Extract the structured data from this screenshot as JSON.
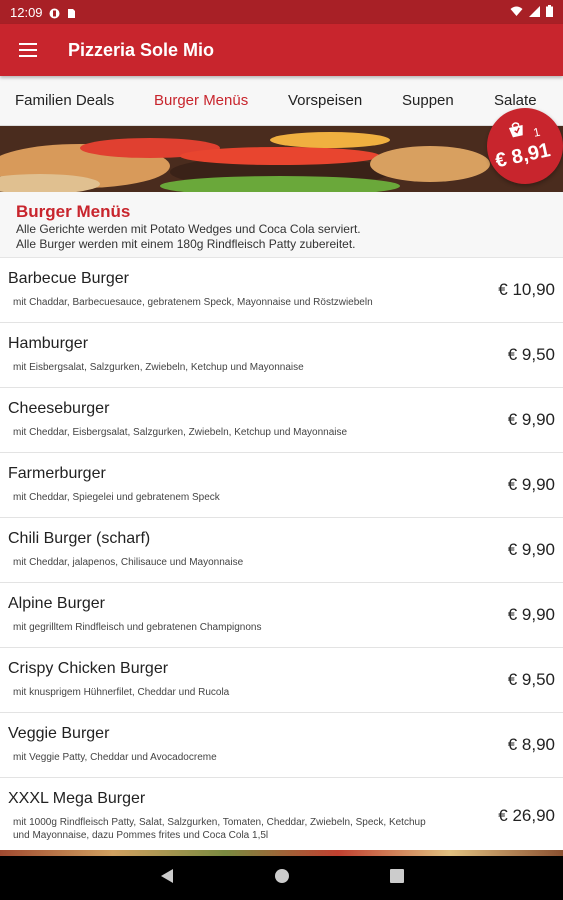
{
  "status_bar": {
    "time": "12:09"
  },
  "app": {
    "title": "Pizzeria Sole Mio"
  },
  "tabs": [
    {
      "label": "Familien Deals",
      "active": false
    },
    {
      "label": "Burger Menüs",
      "active": true
    },
    {
      "label": "Vorspeisen",
      "active": false
    },
    {
      "label": "Suppen",
      "active": false
    },
    {
      "label": "Salate",
      "active": false
    }
  ],
  "cart": {
    "count": "1",
    "total": "€ 8,91"
  },
  "section": {
    "title": "Burger Menüs",
    "desc_line1": "Alle Gerichte werden mit Potato Wedges und Coca Cola serviert.",
    "desc_line2": "Alle Burger werden mit einem 180g Rindfleisch Patty zubereitet."
  },
  "items": [
    {
      "name": "Barbecue Burger",
      "desc": "mit Chaddar, Barbecuesauce, gebratenem Speck, Mayonnaise und Röstzwiebeln",
      "price": "€ 10,90"
    },
    {
      "name": "Hamburger",
      "desc": "mit Eisbergsalat, Salzgurken, Zwiebeln, Ketchup und Mayonnaise",
      "price": "€ 9,50"
    },
    {
      "name": "Cheeseburger",
      "desc": "mit Cheddar, Eisbergsalat, Salzgurken, Zwiebeln, Ketchup und Mayonnaise",
      "price": "€ 9,90"
    },
    {
      "name": "Farmerburger",
      "desc": "mit Cheddar, Spiegelei und gebratenem Speck",
      "price": "€ 9,90"
    },
    {
      "name": "Chili Burger (scharf)",
      "desc": "mit Cheddar, jalapenos, Chilisauce und Mayonnaise",
      "price": "€ 9,90"
    },
    {
      "name": "Alpine Burger",
      "desc": "mit gegrilltem Rindfleisch und gebratenen Champignons",
      "price": "€ 9,90"
    },
    {
      "name": "Crispy Chicken Burger",
      "desc": "mit knusprigem Hühnerfilet, Cheddar und Rucola",
      "price": "€ 9,50"
    },
    {
      "name": "Veggie Burger",
      "desc": "mit Veggie Patty, Cheddar und Avocadocreme",
      "price": "€ 8,90"
    },
    {
      "name": "XXXL Mega Burger",
      "desc": "mit 1000g Rindfleisch Patty, Salat, Salzgurken, Tomaten, Cheddar, Zwiebeln, Speck, Ketchup und Mayonnaise, dazu Pommes frites und Coca Cola 1,5l",
      "price": "€ 26,90"
    }
  ],
  "icons": {
    "menu": "hamburger-menu-icon",
    "cart": "shopping-bag-icon",
    "wifi": "wifi-icon",
    "signal": "signal-icon",
    "battery": "battery-icon",
    "back": "back-triangle-icon",
    "home": "home-circle-icon",
    "recents": "recents-square-icon"
  },
  "colors": {
    "primary": "#c8252d",
    "status_bar": "#a82026"
  }
}
